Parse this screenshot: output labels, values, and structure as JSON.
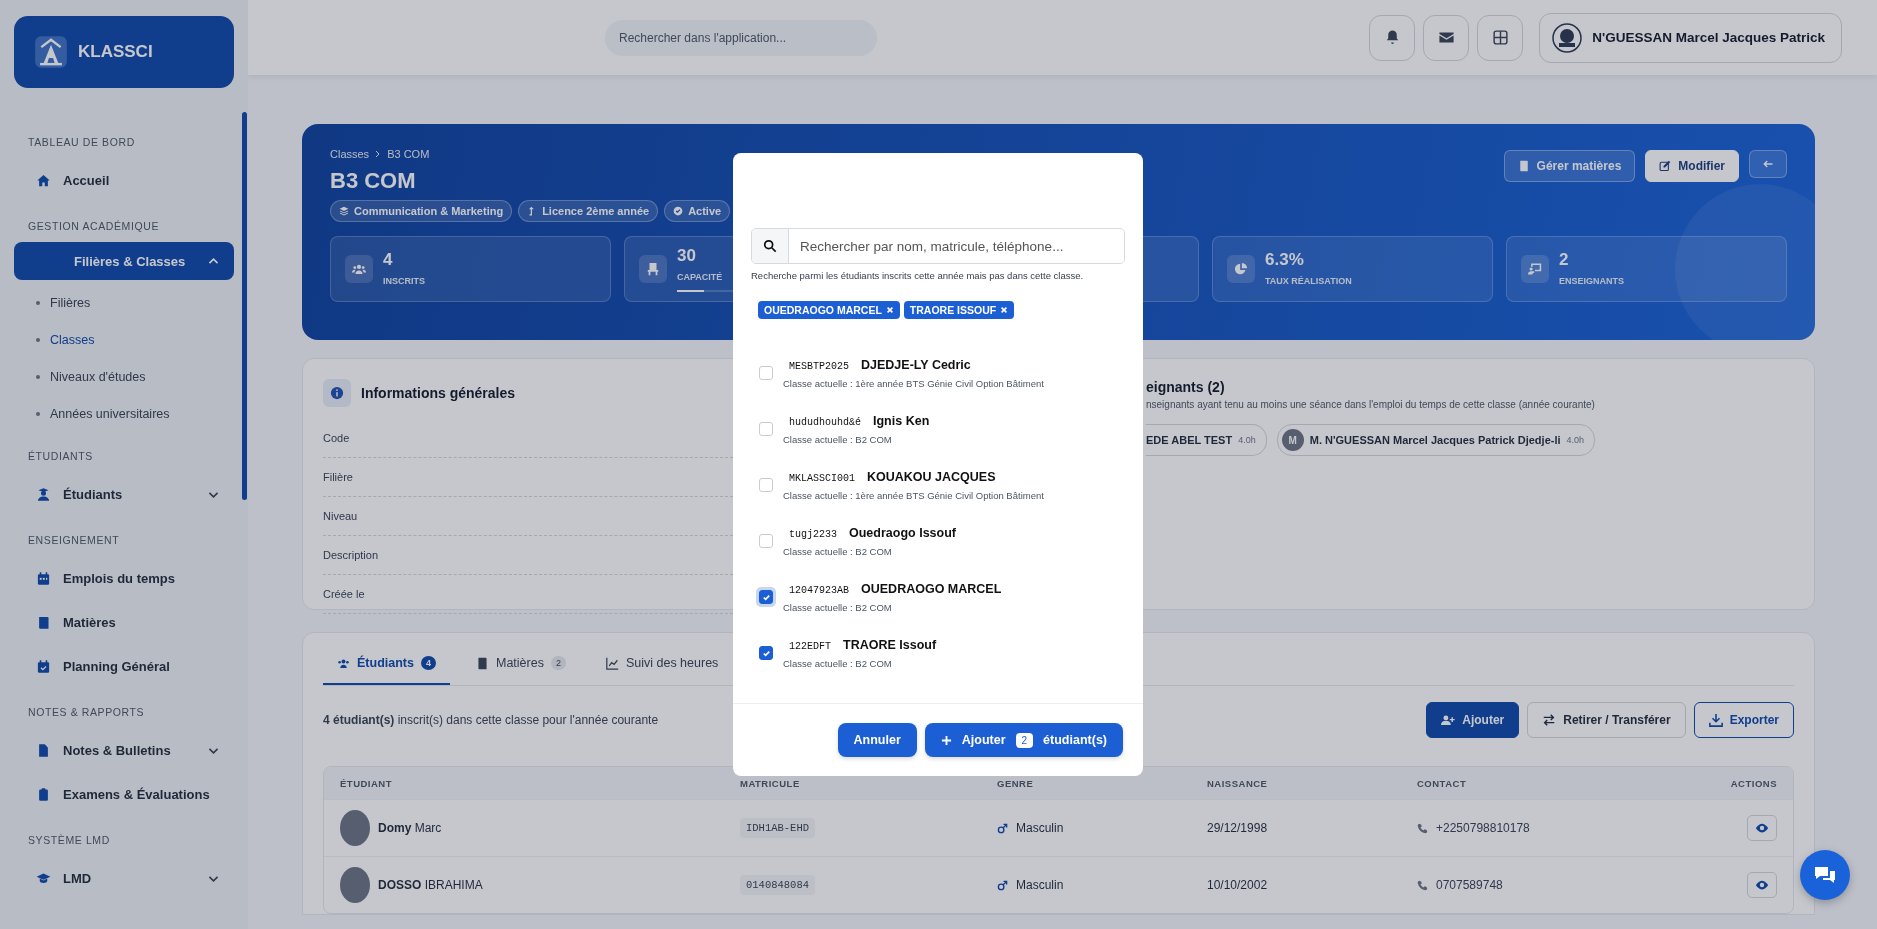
{
  "sidebar": {
    "logo": "KLASSCI",
    "sections": [
      {
        "title": "TABLEAU DE BORD",
        "items": [
          {
            "label": "Accueil",
            "selected": false
          }
        ]
      },
      {
        "title": "GESTION ACADÉMIQUE",
        "items": [
          {
            "label": "Filières & Classes",
            "selected": true,
            "expanded": true,
            "children": [
              {
                "label": "Filières",
                "selected": false
              },
              {
                "label": "Classes",
                "selected": true
              },
              {
                "label": "Niveaux d'études",
                "selected": false
              },
              {
                "label": "Années universitaires",
                "selected": false
              }
            ]
          }
        ]
      },
      {
        "title": "ÉTUDIANTS",
        "items": [
          {
            "label": "Étudiants",
            "selected": false,
            "expanded": false
          }
        ]
      },
      {
        "title": "ENSEIGNEMENT",
        "items": [
          {
            "label": "Emplois du temps",
            "selected": false
          },
          {
            "label": "Matières",
            "selected": false
          },
          {
            "label": "Planning Général",
            "selected": false
          }
        ]
      },
      {
        "title": "NOTES & RAPPORTS",
        "items": [
          {
            "label": "Notes & Bulletins",
            "selected": false,
            "expanded": false
          },
          {
            "label": "Examens & Évaluations",
            "selected": false
          }
        ]
      },
      {
        "title": "SYSTÈME LMD",
        "items": [
          {
            "label": "LMD",
            "selected": false,
            "expanded": false
          }
        ]
      }
    ]
  },
  "header": {
    "search": {
      "placeholder": "Rechercher dans l'application..."
    },
    "user": "N'GUESSAN Marcel Jacques Patrick"
  },
  "hero": {
    "breadcrumb": [
      "Classes",
      "B3 COM"
    ],
    "title": "B3 COM",
    "tags": [
      "Communication & Marketing",
      "Licence 2ème année",
      "Active"
    ],
    "actions": [
      "Gérer matières",
      "Modifier"
    ],
    "stats": [
      {
        "value": "4",
        "label": "INSCRITS"
      },
      {
        "value": "30",
        "label": "CAPACITÉ",
        "level": 0.13
      },
      {
        "value": "6.3%",
        "label": "TAUX RÉALISATION"
      },
      {
        "value": "2",
        "label": "ENSEIGNANTS"
      }
    ]
  },
  "info": {
    "title": "Informations générales",
    "fields": [
      "Code",
      "Filière",
      "Niveau",
      "Description",
      "Créée le"
    ]
  },
  "teachers": {
    "title": "eignants (2)",
    "note": "nseignants ayant tenu au moins une séance dans l'emploi du temps de cette classe (année courante)",
    "items": [
      {
        "name": "EDE ABEL TEST",
        "hours": "4.0h"
      },
      {
        "initial": "M",
        "name": "M. N'GUESSAN Marcel Jacques Patrick Djedje-li",
        "hours": "4.0h"
      }
    ]
  },
  "students": {
    "tabs": [
      {
        "label": "Étudiants",
        "count": "4",
        "selected": true
      },
      {
        "label": "Matières",
        "count": "2",
        "selected": false
      },
      {
        "label": "Suivi des heures",
        "selected": false
      }
    ],
    "summary": "**4 étudiant(s)** inscrit(s) dans cette classe pour l'année courante",
    "buttons": [
      {
        "label": "Ajouter",
        "kind": "primary"
      },
      {
        "label": "Retirer / Transférer",
        "kind": "default"
      },
      {
        "label": "Exporter",
        "kind": "outline"
      }
    ],
    "table": {
      "columns": [
        "ÉTUDIANT",
        "MATRICULE",
        "GENRE",
        "NAISSANCE",
        "CONTACT",
        "ACTIONS"
      ],
      "rows": [
        {
          "name": "**Domy** Marc",
          "matricule": "IDH1AB-EHD",
          "genre": "Masculin",
          "naissance": "29/12/1998",
          "contact": "+2250798810178"
        },
        {
          "name": "**DOSSO** IBRAHIMA",
          "matricule": "0140848084",
          "genre": "Masculin",
          "naissance": "10/10/2002",
          "contact": "0707589748"
        }
      ]
    }
  },
  "modal": {
    "search": {
      "placeholder": "Rechercher par nom, matricule, téléphone..."
    },
    "hint": "Recherche parmi les étudiants inscrits cette année mais pas dans cette classe.",
    "chips": [
      "OUEDRAOGO MARCEL",
      "TRAORE ISSOUF"
    ],
    "candidates": [
      {
        "matricule": "MESBTP2025",
        "name": "DJEDJE-LY Cedric",
        "current": "Classe actuelle : 1ère année BTS Génie Civil Option Bâtiment",
        "checked": false,
        "focused": false
      },
      {
        "matricule": "hududhouhd&é",
        "name": "Ignis Ken",
        "current": "Classe actuelle : B2 COM",
        "checked": false,
        "focused": false
      },
      {
        "matricule": "MKLASSCI001",
        "name": "KOUAKOU JACQUES",
        "current": "Classe actuelle : 1ère année BTS Génie Civil Option Bâtiment",
        "checked": false,
        "focused": false
      },
      {
        "matricule": "tugj2233",
        "name": "Ouedraogo Issouf",
        "current": "Classe actuelle : B2 COM",
        "checked": false,
        "focused": false
      },
      {
        "matricule": "12047923AB",
        "name": "OUEDRAOGO MARCEL",
        "current": "Classe actuelle : B2 COM",
        "checked": true,
        "focused": true
      },
      {
        "matricule": "122EDFT",
        "name": "TRAORE Issouf",
        "current": "Classe actuelle : B2 COM",
        "checked": true,
        "focused": false
      }
    ],
    "cancel": "Annuler",
    "add": {
      "label": "Ajouter",
      "count": "2",
      "suffix": "étudiant(s)"
    }
  }
}
